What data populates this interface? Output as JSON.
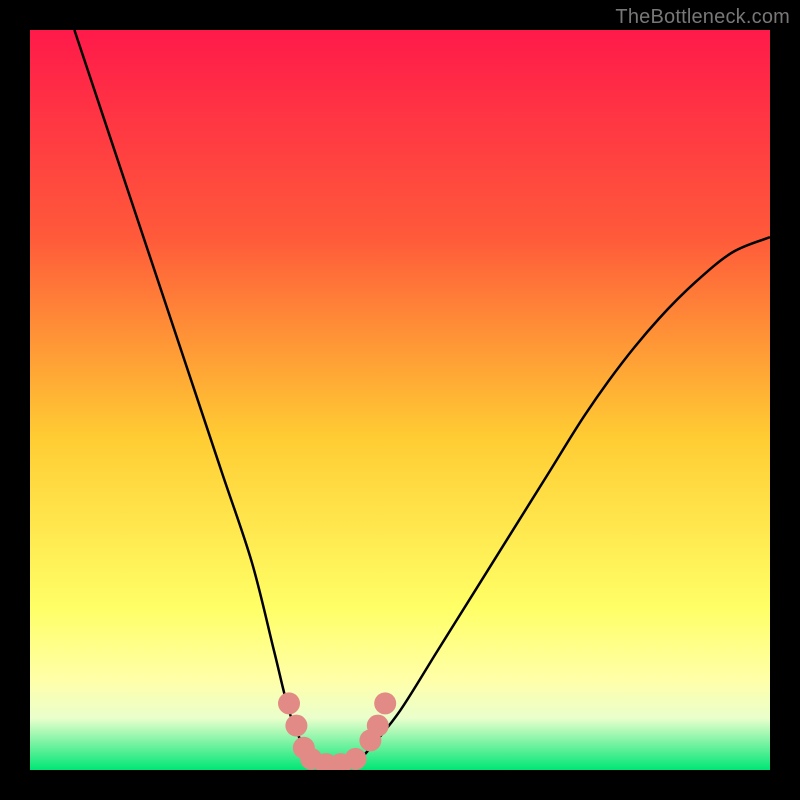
{
  "watermark": "TheBottleneck.com",
  "chart_data": {
    "type": "line",
    "title": "",
    "xlabel": "",
    "ylabel": "",
    "xlim": [
      0,
      100
    ],
    "ylim": [
      0,
      100
    ],
    "background_gradient": {
      "top": "#ff1a4a",
      "mid_upper": "#ff7a2a",
      "mid": "#ffe633",
      "lower": "#ffff99",
      "bottom": "#00e676"
    },
    "series": [
      {
        "name": "bottleneck-curve",
        "x": [
          6,
          10,
          14,
          18,
          22,
          26,
          30,
          33,
          35,
          37,
          38,
          40,
          42,
          44,
          46,
          50,
          55,
          60,
          65,
          70,
          75,
          80,
          85,
          90,
          95,
          100
        ],
        "y": [
          100,
          88,
          76,
          64,
          52,
          40,
          28,
          16,
          8,
          3,
          1,
          0.5,
          0.5,
          1,
          3,
          8,
          16,
          24,
          32,
          40,
          48,
          55,
          61,
          66,
          70,
          72
        ]
      }
    ],
    "markers": {
      "name": "highlight-points",
      "color": "#e28b86",
      "points": [
        {
          "x": 35,
          "y": 9
        },
        {
          "x": 36,
          "y": 6
        },
        {
          "x": 37,
          "y": 3
        },
        {
          "x": 38,
          "y": 1.5
        },
        {
          "x": 40,
          "y": 0.8
        },
        {
          "x": 42,
          "y": 0.8
        },
        {
          "x": 44,
          "y": 1.5
        },
        {
          "x": 46,
          "y": 4
        },
        {
          "x": 47,
          "y": 6
        },
        {
          "x": 48,
          "y": 9
        }
      ]
    }
  }
}
